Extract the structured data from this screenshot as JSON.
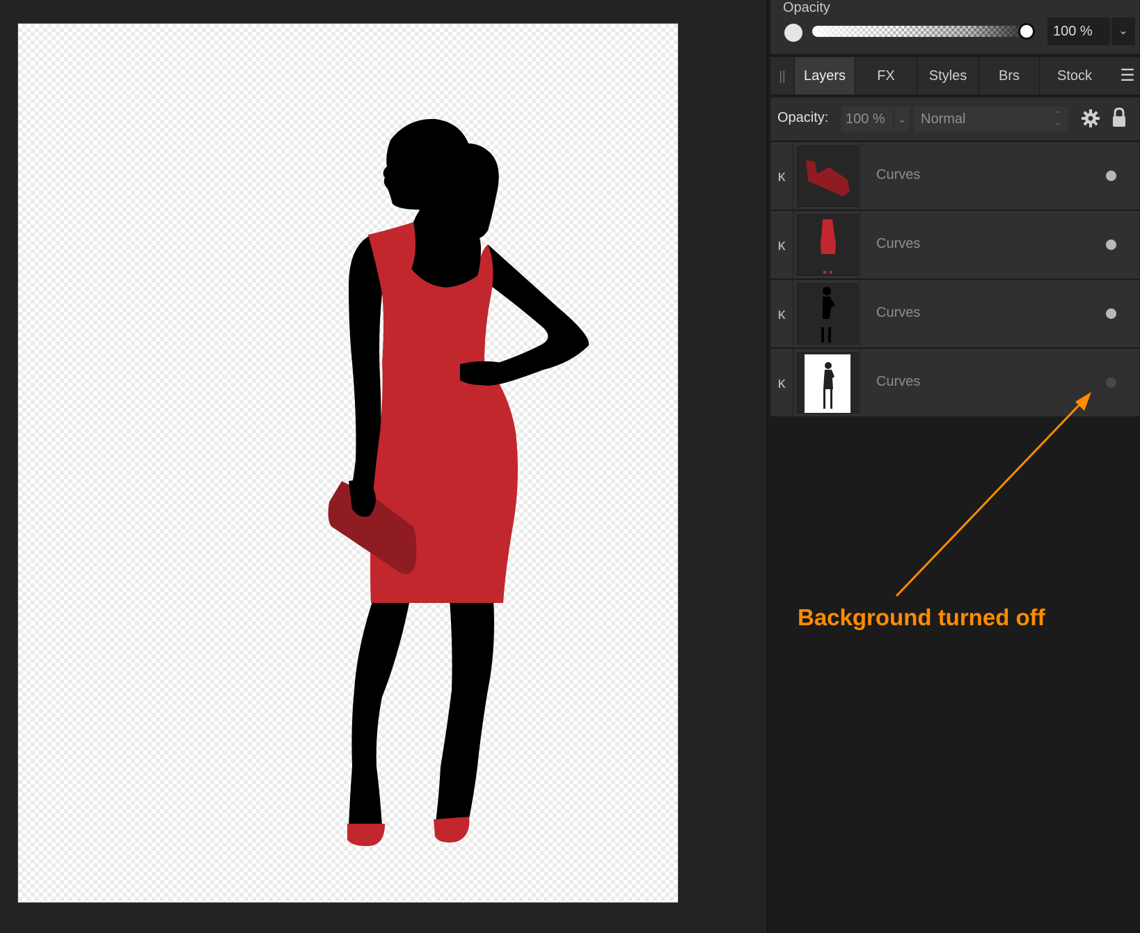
{
  "opacity_panel": {
    "title": "Opacity",
    "value": "100 %",
    "slider_level": 1.0
  },
  "tabs": [
    {
      "label": "Layers",
      "active": true
    },
    {
      "label": "FX",
      "active": false
    },
    {
      "label": "Styles",
      "active": false
    },
    {
      "label": "Brs",
      "active": false
    },
    {
      "label": "Stock",
      "active": false
    }
  ],
  "layer_options": {
    "opacity_label": "Opacity:",
    "opacity_value": "100 %",
    "blend_mode": "Normal"
  },
  "layers": [
    {
      "name": "Curves",
      "visible": true,
      "thumbnail": "red-clutch"
    },
    {
      "name": "Curves",
      "visible": true,
      "thumbnail": "red-dress"
    },
    {
      "name": "Curves",
      "visible": true,
      "thumbnail": "black-silhouette"
    },
    {
      "name": "Curves",
      "visible": false,
      "thumbnail": "background-white"
    }
  ],
  "annotation": {
    "text": "Background turned off",
    "color": "#ff8c00"
  },
  "colors": {
    "dress_red": "#c1272d",
    "clutch_red": "#8f1c22",
    "silhouette": "#000000"
  }
}
